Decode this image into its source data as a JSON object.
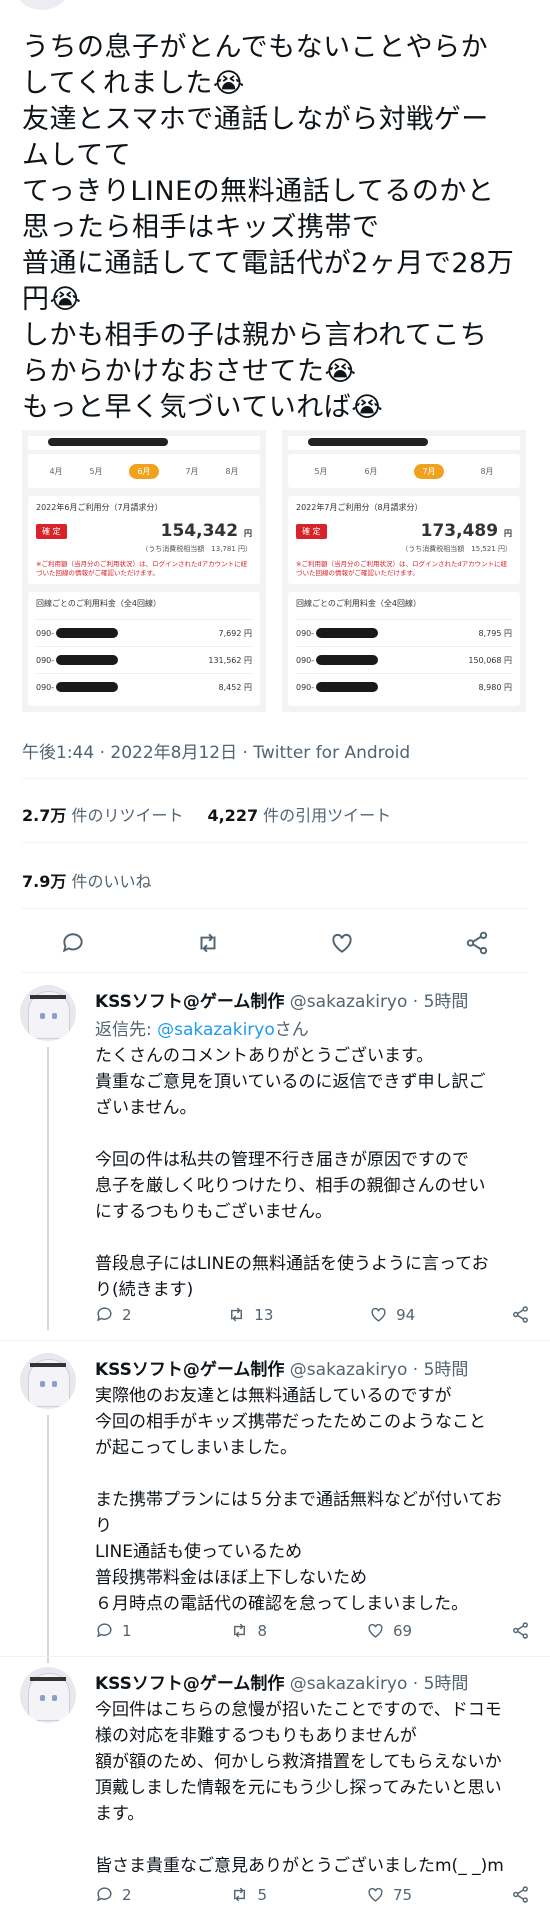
{
  "tweet": {
    "text": "うちの息子がとんでもないことやらか\nしてくれました😭\n友達とスマホで通話しながら対戦ゲー\nムしてて\nてっきりLINEの無料通話してるのかと\n思ったら相手はキッズ携帯で\n普通に通話してて電話代が2ヶ月で28万\n円😭\nしかも相手の子は親から言われてこち\nらからかけなおさせてた😭\nもっと早く気づいていれば😭",
    "timestamp": "午後1:44 · 2022年8月12日 · Twitter for Android",
    "retweets_count": "2.7万",
    "retweets_label": "件のリツイート",
    "quotes_count": "4,227",
    "quotes_label": "件の引用ツイート",
    "likes_count": "7.9万",
    "likes_label": "件のいいね"
  },
  "bills": [
    {
      "months": [
        "4月",
        "5月",
        "6月",
        "7月",
        "8月"
      ],
      "selected": "6月",
      "period": "2022年6月ご利用分（7月請求分）",
      "status": "確 定",
      "amount": "154,342",
      "yen": "円",
      "tax": "（うち消費税相当額　13,781 円）",
      "note": "※ご利用額（当月分のご利用状況）は、ログインされたdアカウントに紐づいた回線の情報がご確認いただけます。",
      "lines_title": "回線ごとのご利用料金（全4回線）",
      "lines": [
        {
          "prefix": "090-",
          "amount": "7,692 円"
        },
        {
          "prefix": "090-",
          "amount": "131,562 円"
        },
        {
          "prefix": "090-",
          "amount": "8,452 円"
        }
      ]
    },
    {
      "months": [
        "5月",
        "6月",
        "7月",
        "8月"
      ],
      "selected": "7月",
      "period": "2022年7月ご利用分（8月請求分）",
      "status": "確 定",
      "amount": "173,489",
      "yen": "円",
      "tax": "（うち消費税相当額　15,521 円）",
      "note": "※ご利用額（当月分のご利用状況）は、ログインされたdアカウントに紐づいた回線の情報がご確認いただけます。",
      "lines_title": "回線ごとのご利用料金（全4回線）",
      "lines": [
        {
          "prefix": "090-",
          "amount": "8,795 円"
        },
        {
          "prefix": "090-",
          "amount": "150,068 円"
        },
        {
          "prefix": "090-",
          "amount": "8,980 円"
        }
      ]
    }
  ],
  "replies": [
    {
      "name": "KSSソフト@ゲーム制作",
      "handle": "@sakazakiryo · 5時間",
      "reply_to_prefix": "返信先: ",
      "reply_to_user": "@sakazakiryo",
      "reply_to_suffix": "さん",
      "text": "たくさんのコメントありがとうございます。\n貴重なご意見を頂いているのに返信できず申し訳ご\nざいません。\n\n今回の件は私共の管理不行き届きが原因ですので\n息子を厳しく叱りつけたり、相手の親御さんのせい\nにするつもりもございません。\n\n普段息子にはLINEの無料通話を使うように言ってお\nり(続きます)",
      "replies": "2",
      "retweets": "13",
      "likes": "94"
    },
    {
      "name": "KSSソフト@ゲーム制作",
      "handle": "@sakazakiryo · 5時間",
      "text": "実際他のお友達とは無料通話しているのですが\n今回の相手がキッズ携帯だったためこのようなこと\nが起こってしまいました。\n\nまた携帯プランには５分まで通話無料などが付いてお\nり\nLINE通話も使っているため\n普段携帯料金はほぼ上下しないため\n６月時点の電話代の確認を怠ってしまいました。",
      "replies": "1",
      "retweets": "8",
      "likes": "69"
    },
    {
      "name": "KSSソフト@ゲーム制作",
      "handle": "@sakazakiryo · 5時間",
      "text": "今回件はこちらの怠慢が招いたことですので、ドコモ\n様の対応を非難するつもりもありませんが\n額が額のため、何かしら救済措置をしてもらえないか\n頂戴しました情報を元にもう少し探ってみたいと思い\nます。\n\n皆さま貴重なご意見ありがとうございましたm(_ _)m",
      "replies": "2",
      "retweets": "5",
      "likes": "75"
    }
  ],
  "icons": [
    "reply-icon",
    "retweet-icon",
    "like-icon",
    "share-icon"
  ],
  "colors": {
    "accent": "#1d9bf0",
    "bill_accent": "#f0a21c",
    "bill_red": "#d8232a",
    "muted": "#536471"
  }
}
